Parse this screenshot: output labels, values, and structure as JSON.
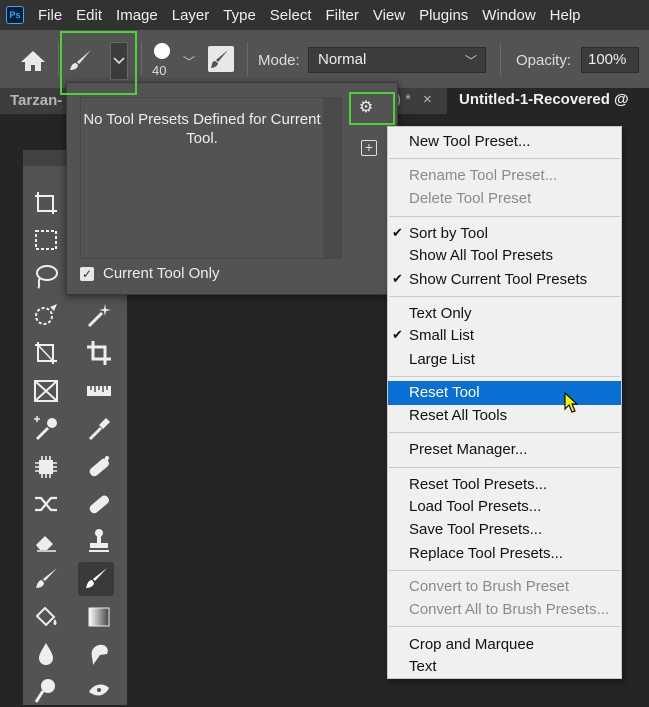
{
  "app_logo": "Ps",
  "menu": [
    "File",
    "Edit",
    "Image",
    "Layer",
    "Type",
    "Select",
    "Filter",
    "View",
    "Plugins",
    "Window",
    "Help"
  ],
  "options": {
    "brush_size": "40",
    "mode_label": "Mode:",
    "mode_value": "Normal",
    "opacity_label": "Opacity:",
    "opacity_value": "100%"
  },
  "tabs": {
    "tab1": "Tarzan-",
    "tab_mid": ") *",
    "tab_close": "×",
    "tab2": "Untitled-1-Recovered @ "
  },
  "presets_popup": {
    "message": "No Tool Presets Defined for Current Tool.",
    "checkbox_label": "Current Tool Only",
    "checkbox_checked": true
  },
  "context_menu": {
    "items": [
      {
        "label": "New Tool Preset...",
        "checked": false,
        "disabled": false
      },
      {
        "label": "Rename Tool Preset...",
        "checked": false,
        "disabled": true
      },
      {
        "label": "Delete Tool Preset",
        "checked": false,
        "disabled": true
      },
      {
        "label": "Sort by Tool",
        "checked": true,
        "disabled": false
      },
      {
        "label": "Show All Tool Presets",
        "checked": false,
        "disabled": false
      },
      {
        "label": "Show Current Tool Presets",
        "checked": true,
        "disabled": false
      },
      {
        "label": "Text Only",
        "checked": false,
        "disabled": false
      },
      {
        "label": "Small List",
        "checked": true,
        "disabled": false
      },
      {
        "label": "Large List",
        "checked": false,
        "disabled": false
      },
      {
        "label": "Reset Tool",
        "checked": false,
        "disabled": false,
        "active": true
      },
      {
        "label": "Reset All Tools",
        "checked": false,
        "disabled": false
      },
      {
        "label": "Preset Manager...",
        "checked": false,
        "disabled": false
      },
      {
        "label": "Reset Tool Presets...",
        "checked": false,
        "disabled": false
      },
      {
        "label": "Load Tool Presets...",
        "checked": false,
        "disabled": false
      },
      {
        "label": "Save Tool Presets...",
        "checked": false,
        "disabled": false
      },
      {
        "label": "Replace Tool Presets...",
        "checked": false,
        "disabled": false
      },
      {
        "label": "Convert to Brush Preset",
        "checked": false,
        "disabled": true
      },
      {
        "label": "Convert All to Brush Presets...",
        "checked": false,
        "disabled": true
      },
      {
        "label": "Crop and Marquee",
        "checked": false,
        "disabled": false
      },
      {
        "label": "Text",
        "checked": false,
        "disabled": false
      }
    ]
  },
  "colors": {
    "highlight": "#4cd137",
    "menu_active": "#0a6fd5"
  }
}
